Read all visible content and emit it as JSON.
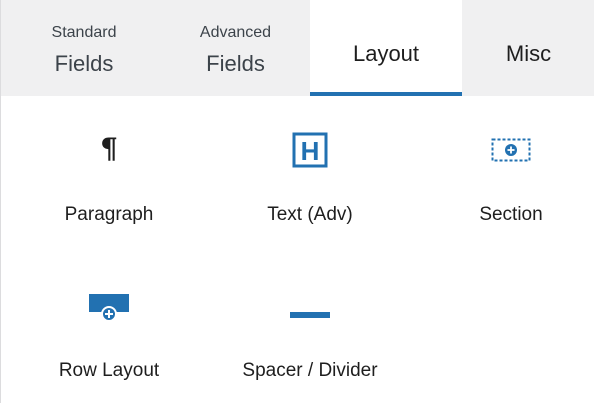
{
  "tabs": {
    "standard": {
      "sub": "Standard",
      "main": "Fields"
    },
    "advanced": {
      "sub": "Advanced",
      "main": "Fields"
    },
    "layout": {
      "label": "Layout",
      "active": true
    },
    "misc": {
      "label": "Misc"
    }
  },
  "accent_color": "#2271b1",
  "items": [
    {
      "label": "Paragraph",
      "icon": "paragraph-icon"
    },
    {
      "label": "Text (Adv)",
      "icon": "heading-icon"
    },
    {
      "label": "Section",
      "icon": "section-icon"
    },
    {
      "label": "Row Layout",
      "icon": "row-layout-icon"
    },
    {
      "label": "Spacer / Divider",
      "icon": "divider-icon"
    }
  ],
  "icons": {
    "paragraph_glyph": "¶",
    "heading_glyph": "H"
  }
}
